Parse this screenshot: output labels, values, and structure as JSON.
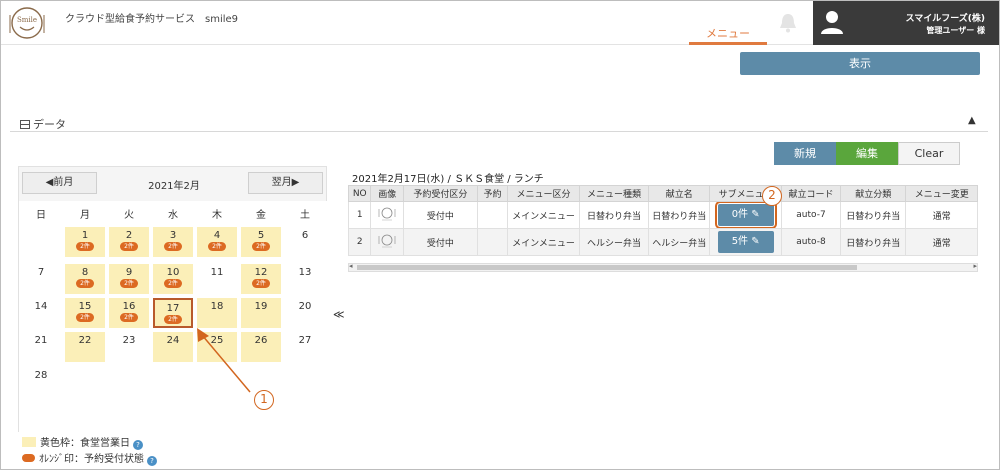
{
  "header": {
    "app_title": "クラウド型給食予約サービス　smile9",
    "menu_tab": "メニュー",
    "company": "スマイルフーズ(株)",
    "admin": "管理ユーザー 様",
    "logo_text": "Smile"
  },
  "toolbar": {
    "display_label": "表示"
  },
  "section": {
    "data_label": "データ"
  },
  "actions": {
    "new_label": "新規",
    "edit_label": "編集",
    "clear_label": "Clear"
  },
  "calendar": {
    "prev_label": "◀前月",
    "next_label": "翌月▶",
    "month": "2021年2月",
    "weekdays": [
      "日",
      "月",
      "火",
      "水",
      "木",
      "金",
      "土"
    ],
    "weeks": [
      [
        {
          "d": ""
        },
        {
          "d": "1",
          "biz": true,
          "badge": "2件"
        },
        {
          "d": "2",
          "biz": true,
          "badge": "2件"
        },
        {
          "d": "3",
          "biz": true,
          "badge": "2件"
        },
        {
          "d": "4",
          "biz": true,
          "badge": "2件"
        },
        {
          "d": "5",
          "biz": true,
          "badge": "2件"
        },
        {
          "d": "6"
        }
      ],
      [
        {
          "d": "7"
        },
        {
          "d": "8",
          "biz": true,
          "badge": "2件"
        },
        {
          "d": "9",
          "biz": true,
          "badge": "2件"
        },
        {
          "d": "10",
          "biz": true,
          "badge": "2件"
        },
        {
          "d": "11"
        },
        {
          "d": "12",
          "biz": true,
          "badge": "2件"
        },
        {
          "d": "13"
        }
      ],
      [
        {
          "d": "14"
        },
        {
          "d": "15",
          "biz": true,
          "badge": "2件"
        },
        {
          "d": "16",
          "biz": true,
          "badge": "2件"
        },
        {
          "d": "17",
          "biz": true,
          "badge": "2件",
          "selected": true
        },
        {
          "d": "18",
          "biz": true
        },
        {
          "d": "19",
          "biz": true
        },
        {
          "d": "20"
        }
      ],
      [
        {
          "d": "21"
        },
        {
          "d": "22",
          "biz": true
        },
        {
          "d": "23"
        },
        {
          "d": "24",
          "biz": true
        },
        {
          "d": "25",
          "biz": true
        },
        {
          "d": "26",
          "biz": true
        },
        {
          "d": "27"
        }
      ],
      [
        {
          "d": "28"
        },
        {
          "d": ""
        },
        {
          "d": ""
        },
        {
          "d": ""
        },
        {
          "d": ""
        },
        {
          "d": ""
        },
        {
          "d": ""
        }
      ]
    ]
  },
  "legend": {
    "business_day": "黄色枠：食堂営業日",
    "reservation_status": "ｵﾚﾝｼﾞ印：予約受付状態",
    "help": "?"
  },
  "collapse_left": "≪",
  "table": {
    "title": "2021年2月17日(水) / ＳＫＳ食堂 / ランチ",
    "headers": [
      "NO",
      "画像",
      "予約受付区分",
      "予約",
      "メニュー区分",
      "メニュー種類",
      "献立名",
      "サブメニュー",
      "献立コード",
      "献立分類",
      "メニュー変更"
    ],
    "rows": [
      {
        "no": "1",
        "status": "受付中",
        "reserve": "",
        "category": "メインメニュー",
        "type": "日替わり弁当",
        "name": "日替わり弁当",
        "sub": "0件",
        "code": "auto-7",
        "class": "日替わり弁当",
        "change": "通常"
      },
      {
        "no": "2",
        "status": "受付中",
        "reserve": "",
        "category": "メインメニュー",
        "type": "ヘルシー弁当",
        "name": "ヘルシー弁当",
        "sub": "5件",
        "code": "auto-8",
        "class": "日替わり弁当",
        "change": "通常"
      }
    ]
  },
  "annotations": {
    "one": "1",
    "two": "2"
  },
  "colors": {
    "accent": "#e07a3f",
    "primary": "#5d8ba8",
    "edit": "#5aa63c",
    "business": "#fbefb8",
    "badge": "#dc6a22"
  }
}
